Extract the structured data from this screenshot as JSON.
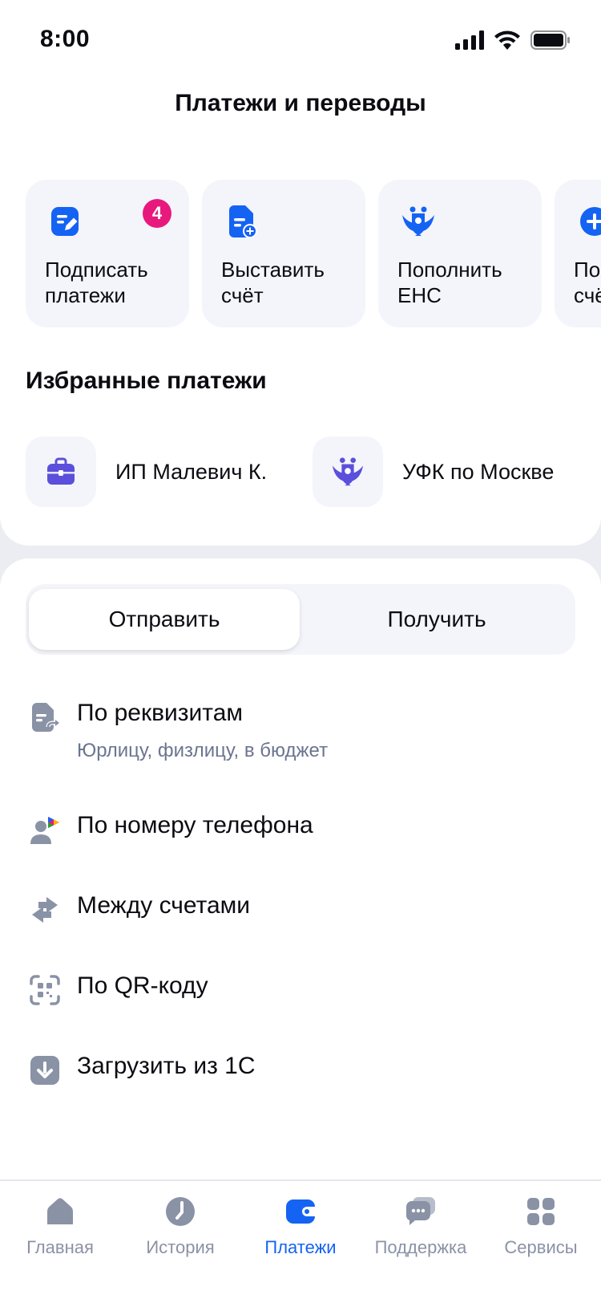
{
  "status_bar": {
    "time": "8:00"
  },
  "header": {
    "title": "Платежи и переводы"
  },
  "actions": [
    {
      "label": "Подписать\nплатежи",
      "icon": "sign-document-icon",
      "badge": "4"
    },
    {
      "label": "Выставить\nсчёт",
      "icon": "invoice-add-icon"
    },
    {
      "label": "Пополнить\nЕНС",
      "icon": "eagle-emblem-icon"
    },
    {
      "label": "Пополнить\nсчёт",
      "icon": "plus-circle-icon"
    }
  ],
  "favorites": {
    "title": "Избранные платежи",
    "items": [
      {
        "name": "ИП Малевич К.",
        "icon": "briefcase-icon"
      },
      {
        "name": "УФК по Москве",
        "icon": "eagle-emblem-icon"
      }
    ]
  },
  "segment": {
    "send": "Отправить",
    "receive": "Получить"
  },
  "menu": [
    {
      "label": "По реквизитам",
      "sub": "Юрлицу, физлицу, в бюджет",
      "icon": "document-transfer-icon"
    },
    {
      "label": "По номеру телефона",
      "icon": "person-sbp-icon"
    },
    {
      "label": "Между счетами",
      "icon": "swap-arrows-icon"
    },
    {
      "label": "По QR-коду",
      "icon": "qr-scan-icon"
    },
    {
      "label": "Загрузить из 1С",
      "icon": "download-icon"
    }
  ],
  "tabs": [
    {
      "label": "Главная",
      "icon": "home-icon"
    },
    {
      "label": "История",
      "icon": "clock-icon"
    },
    {
      "label": "Платежи",
      "icon": "wallet-icon",
      "active": true
    },
    {
      "label": "Поддержка",
      "icon": "chat-icon"
    },
    {
      "label": "Сервисы",
      "icon": "grid-icon"
    }
  ],
  "colors": {
    "accent": "#1463f3",
    "badge": "#e8197d",
    "icon_gray": "#8a92a6",
    "card_bg": "#f4f5fa",
    "purple": "#5b4fdc"
  }
}
